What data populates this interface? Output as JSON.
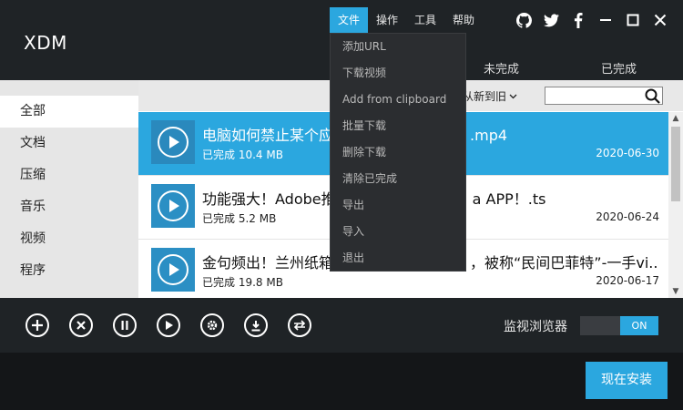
{
  "app": {
    "title": "XDM"
  },
  "menu": [
    "文件",
    "操作",
    "工具",
    "帮助"
  ],
  "window_icons": [
    "github-icon",
    "twitter-icon",
    "facebook-icon",
    "minimize-icon",
    "maximize-icon",
    "close-icon"
  ],
  "tabs": {
    "incomplete": "未完成",
    "complete": "已完成"
  },
  "sidebar": {
    "items": [
      {
        "label": "全部"
      },
      {
        "label": "文档"
      },
      {
        "label": "压缩"
      },
      {
        "label": "音乐"
      },
      {
        "label": "视频"
      },
      {
        "label": "程序"
      }
    ]
  },
  "toolbar": {
    "sort_label": "从新到旧",
    "search_value": ""
  },
  "downloads": [
    {
      "name": "电脑如何禁止某个应",
      "name_tail": ".mp4",
      "status": "已完成",
      "size": "10.4 MB",
      "date": "2020-06-30"
    },
    {
      "name": "功能强大！Adobe推",
      "name_tail": "a APP！.ts",
      "status": "已完成",
      "size": "5.2 MB",
      "date": "2020-06-24"
    },
    {
      "name": "金句频出！兰州纸箱",
      "name_tail": "，被称“民间巴菲特”-一手vi...",
      "status": "已完成",
      "size": "19.8 MB",
      "date": "2020-06-17"
    }
  ],
  "dropdown": {
    "items": [
      "添加URL",
      "下载视频",
      "Add from clipboard",
      "批量下载",
      "删除下载",
      "清除已完成",
      "导出",
      "导入",
      "退出"
    ]
  },
  "bottom": {
    "buttons": [
      "add-icon",
      "cancel-icon",
      "pause-icon",
      "resume-icon",
      "settings-icon",
      "download-icon",
      "convert-icon"
    ],
    "monitor_label": "监视浏览器",
    "toggle_label": "ON"
  },
  "footer": {
    "install_label": "现在安装"
  },
  "colors": {
    "accent": "#2ba7df",
    "dark": "#1f2326"
  }
}
